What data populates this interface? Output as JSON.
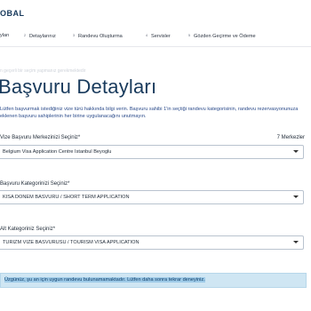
{
  "header": {
    "logo_text": "OBAL"
  },
  "steps": [
    {
      "num": "",
      "label": "yları"
    },
    {
      "num": "2",
      "label": "Detaylarınız"
    },
    {
      "num": "3",
      "label": "Randevu Oluşturma"
    },
    {
      "num": "4",
      "label": "Servisler"
    },
    {
      "num": "5",
      "label": "Gözden Geçirme ve Ödeme"
    }
  ],
  "main": {
    "faded_text": "n geçerli bir seçim yapmanız gerekmektedir",
    "title": "Başvuru Detayları",
    "description": "Lütfen başvurmak istediğiniz vize türü hakkında bilgi verin. Başvuru sahibi 1'in seçtiği randevu kategorisinin, randevu rezervasyonunuza eklenen başvuru sahiplerinin her birine uygulanacağını unutmayın.",
    "fields": [
      {
        "label": "Vize Başvuru Merkezinizi Seçiniz*",
        "value": "Belgium Visa Application Centre Istanbul Beyoglu",
        "counter": "7 Merkezler"
      },
      {
        "label": "Başvuru Kategorinizi Seçiniz*",
        "value": "KISA DONEM BASVURU / SHORT TERM APPLICATION"
      },
      {
        "label": "Alt Kategoriniz Seçiniz*",
        "value": "TURIZM VIZE BASVURUSU / TOURISM VISA APPLICATION"
      }
    ],
    "alert": "Üzgünüz, şu an için uygun randevu bulunamamaktadır. Lütfen daha sonra tekrar deneyiniz."
  },
  "colors": {
    "brand": "#183a5c",
    "alert_bg": "#cfe6f3",
    "border": "#b9c3cf"
  }
}
